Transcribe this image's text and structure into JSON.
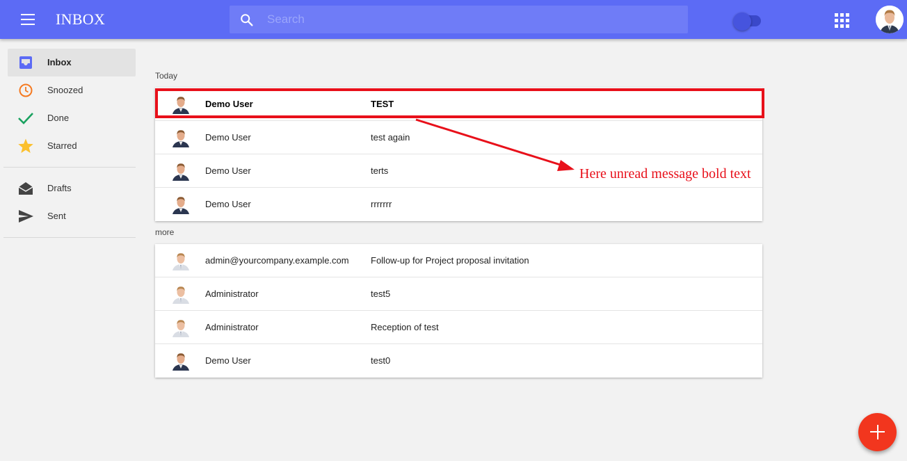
{
  "header": {
    "title": "INBOX",
    "search_placeholder": "Search",
    "search_value": "",
    "menu_icon": "menu-icon",
    "apps_icon": "apps-grid-icon",
    "toggle_state": "off"
  },
  "sidebar": {
    "items": [
      {
        "label": "Inbox",
        "icon": "inbox-icon",
        "active": true,
        "color": "#5c6bf5"
      },
      {
        "label": "Snoozed",
        "icon": "clock-icon",
        "active": false,
        "color": "#f5791f"
      },
      {
        "label": "Done",
        "icon": "check-icon",
        "active": false,
        "color": "#1aa260"
      },
      {
        "label": "Starred",
        "icon": "star-icon",
        "active": false,
        "color": "#fbc02d"
      },
      {
        "label": "Drafts",
        "icon": "drafts-icon",
        "active": false,
        "color": "#444444"
      },
      {
        "label": "Sent",
        "icon": "send-icon",
        "active": false,
        "color": "#444444"
      }
    ]
  },
  "sections": [
    {
      "label": "Today",
      "messages": [
        {
          "sender": "Demo User",
          "subject": "TEST",
          "unread": true
        },
        {
          "sender": "Demo User",
          "subject": "test again",
          "unread": false
        },
        {
          "sender": "Demo User",
          "subject": "terts",
          "unread": false
        },
        {
          "sender": "Demo User",
          "subject": "rrrrrrr",
          "unread": false
        }
      ]
    },
    {
      "label": "more",
      "messages": [
        {
          "sender": "admin@yourcompany.example.com",
          "subject": "Follow-up for Project proposal invitation",
          "unread": false
        },
        {
          "sender": "Administrator",
          "subject": "test5",
          "unread": false
        },
        {
          "sender": "Administrator",
          "subject": "Reception of test",
          "unread": false
        },
        {
          "sender": "Demo User",
          "subject": "test0",
          "unread": false
        }
      ]
    }
  ],
  "annotation": {
    "text": "Here unread message bold text",
    "color": "#e8101a"
  },
  "colors": {
    "header": "#5c6bf5",
    "fab": "#f2361e",
    "background": "#f2f2f2"
  }
}
